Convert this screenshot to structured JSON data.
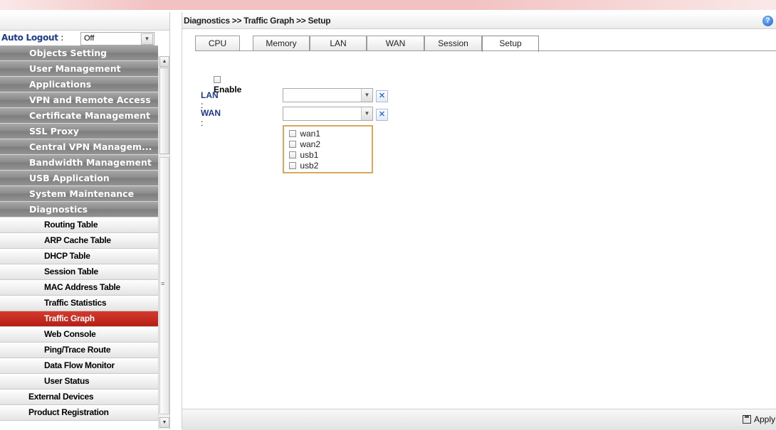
{
  "breadcrumb": "Diagnostics >> Traffic Graph >> Setup",
  "auto_logout": {
    "label": "Auto Logout",
    "sep": " : ",
    "value": "Off"
  },
  "menu": {
    "top_items": [
      "Objects Setting",
      "User Management",
      "Applications",
      "VPN and Remote Access",
      "Certificate Management",
      "SSL Proxy",
      "Central VPN Managem...",
      "Bandwidth Management",
      "USB Application",
      "System Maintenance",
      "Diagnostics"
    ],
    "diagnostics_items": [
      "Routing Table",
      "ARP Cache Table",
      "DHCP Table",
      "Session Table",
      "MAC Address Table",
      "Traffic Statistics",
      "Traffic Graph",
      "Web Console",
      "Ping/Trace Route",
      "Data Flow Monitor",
      "User Status"
    ],
    "bottom_items": [
      "External Devices",
      "Product Registration"
    ]
  },
  "tabs": [
    "CPU",
    "Memory",
    "LAN",
    "WAN",
    "Session",
    "Setup"
  ],
  "form": {
    "enable_label": "Enable",
    "lan_label": "LAN",
    "wan_label": "WAN",
    "sep": " :",
    "wan_options": [
      "wan1",
      "wan2",
      "usb1",
      "usb2"
    ]
  },
  "footer": {
    "apply_label": "Apply"
  },
  "colors": {
    "active_menu": "#c42a20",
    "label_blue": "#1e3a8a",
    "dropdown_border": "#d9a85a"
  },
  "icons": [
    "help-icon",
    "dropdown-arrow-icon",
    "clear-icon",
    "save-icon"
  ]
}
